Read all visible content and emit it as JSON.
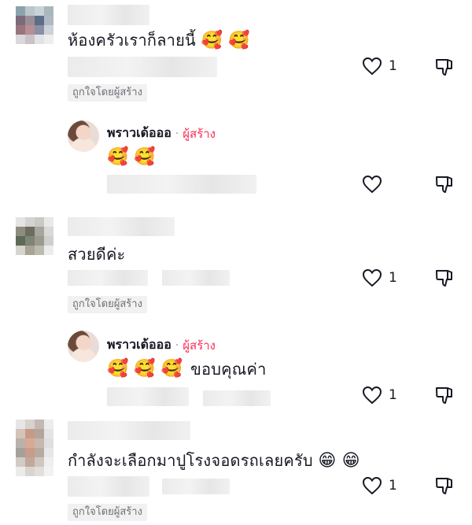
{
  "comments": [
    {
      "text": "ห้องครัวเราก็ลายนี้",
      "emoji": "🥰 🥰",
      "likes": "1",
      "badge": "ถูกใจโดยผู้สร้าง",
      "reply": {
        "name": "พราวเด้อออ",
        "separator": "·",
        "creator_label": "ผู้สร้าง",
        "emoji": "🥰 🥰",
        "text": "",
        "likes": ""
      }
    },
    {
      "text": "สวยดีค่ะ",
      "emoji": "",
      "likes": "1",
      "badge": "ถูกใจโดยผู้สร้าง",
      "reply": {
        "name": "พราวเด้อออ",
        "separator": "·",
        "creator_label": "ผู้สร้าง",
        "emoji": "🥰 🥰 🥰",
        "text": "ขอบคุณค่า",
        "likes": "1"
      }
    },
    {
      "text": "กำลังจะเลือกมาปูโรงจอดรถเลยครับ",
      "emoji": "😁 😁",
      "likes": "1",
      "badge": "ถูกใจโดยผู้สร้าง"
    }
  ],
  "colors": {
    "creator": "#fe2c55",
    "text": "#161823",
    "muted": "#6f7076",
    "badge_bg": "#f1f1f2"
  },
  "icons": {
    "like": "heart-outline-icon",
    "dislike": "thumbs-down-icon"
  }
}
